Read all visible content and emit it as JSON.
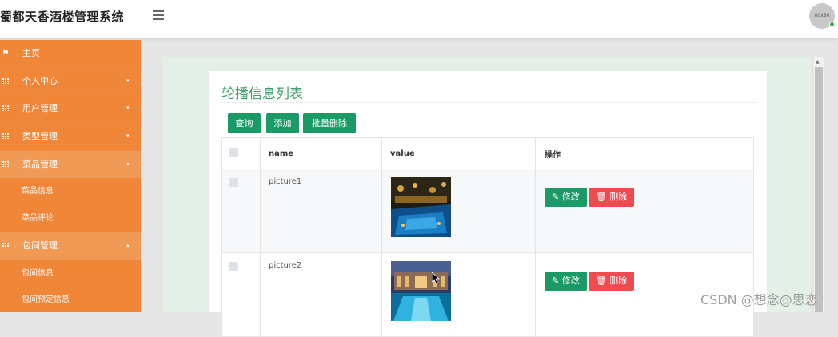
{
  "header": {
    "title": "蜀都天香酒楼管理系统",
    "avatar_text": "80x80"
  },
  "sidebar": {
    "items": [
      {
        "label": "主页",
        "icon": "flag-icon"
      },
      {
        "label": "个人中心",
        "icon": "grid-icon",
        "arrow": "▾"
      },
      {
        "label": "用户管理",
        "icon": "grid-icon",
        "arrow": "▾"
      },
      {
        "label": "类型管理",
        "icon": "grid-icon",
        "arrow": "▾"
      },
      {
        "label": "菜品管理",
        "icon": "grid-icon",
        "arrow": "▴"
      },
      {
        "label": "菜品信息"
      },
      {
        "label": "菜品评论"
      },
      {
        "label": "包间管理",
        "icon": "grid-icon",
        "arrow": "▴"
      },
      {
        "label": "包间信息"
      },
      {
        "label": "包间预定信息"
      }
    ]
  },
  "main": {
    "title": "轮播信息列表",
    "toolbar": {
      "query": "查询",
      "add": "添加",
      "batch_delete": "批量删除"
    },
    "table": {
      "headers": {
        "name": "name",
        "value": "value",
        "actions": "操作"
      },
      "rows": [
        {
          "name": "picture1",
          "edit": "修改",
          "delete": "删除"
        },
        {
          "name": "picture2",
          "edit": "修改",
          "delete": "删除"
        }
      ]
    }
  },
  "watermark": "CSDN @想念@思恋",
  "colors": {
    "sidebar": "#ef8638",
    "primary_button": "#1a9a67",
    "delete_button": "#f0494f",
    "title_green": "#3f9f68"
  }
}
